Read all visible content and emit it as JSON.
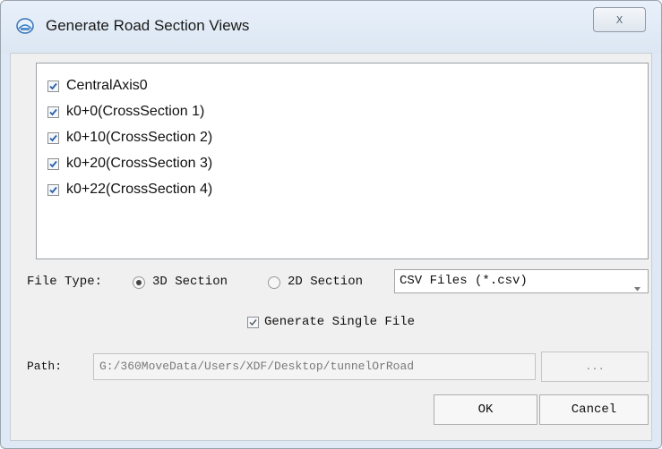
{
  "window": {
    "title": "Generate Road Section Views",
    "close_glyph": "X"
  },
  "items": [
    {
      "label": "CentralAxis0",
      "checked": true
    },
    {
      "label": "k0+0(CrossSection 1)",
      "checked": true
    },
    {
      "label": "k0+10(CrossSection 2)",
      "checked": true
    },
    {
      "label": "k0+20(CrossSection 3)",
      "checked": true
    },
    {
      "label": "k0+22(CrossSection 4)",
      "checked": true
    }
  ],
  "file_type": {
    "label": "File Type:",
    "options": [
      "3D Section",
      "2D Section"
    ],
    "selected": "3D Section",
    "format": "CSV Files (*.csv)"
  },
  "single_file": {
    "label": "Generate Single File",
    "checked": true
  },
  "path": {
    "label": "Path:",
    "value": "G:/360MoveData/Users/XDF/Desktop/tunnelOrRoad",
    "browse_label": "..."
  },
  "buttons": {
    "ok": "OK",
    "cancel": "Cancel"
  },
  "icons": {
    "app": "road-section-app-icon",
    "close": "close-icon",
    "dropdown": "chevron-down-icon"
  }
}
